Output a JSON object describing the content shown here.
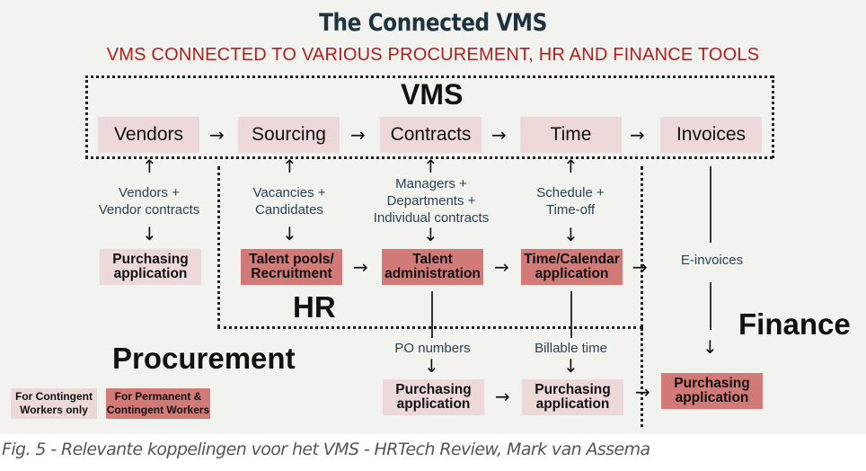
{
  "title": "The Connected VMS",
  "subtitle": "VMS CONNECTED TO VARIOUS PROCUREMENT, HR AND FINANCE TOOLS",
  "zones": {
    "vms": "VMS",
    "hr": "HR",
    "procurement": "Procurement",
    "finance": "Finance"
  },
  "vms_modules": [
    {
      "label": "Vendors"
    },
    {
      "label": "Sourcing"
    },
    {
      "label": "Contracts"
    },
    {
      "label": "Time"
    },
    {
      "label": "Invoices"
    }
  ],
  "flow_notes": {
    "vendors": [
      "Vendors +",
      "Vendor contracts"
    ],
    "sourcing": [
      "Vacancies +",
      "Candidates"
    ],
    "contracts": [
      "Managers +",
      "Departments +",
      "Individual contracts"
    ],
    "time": [
      "Schedule +",
      "Time-off"
    ],
    "e_invoices": "E-invoices",
    "po_numbers": "PO numbers",
    "billable_time": "Billable time"
  },
  "applications": {
    "procurement_purchasing": [
      "Purchasing",
      "application"
    ],
    "talent_pools": [
      "Talent pools/",
      "Recruitment"
    ],
    "talent_admin": [
      "Talent",
      "administration"
    ],
    "time_calendar": [
      "Time/Calendar",
      "application"
    ],
    "purchasing_po": [
      "Purchasing",
      "application"
    ],
    "purchasing_billable": [
      "Purchasing",
      "application"
    ],
    "finance_purchasing": [
      "Purchasing",
      "application"
    ]
  },
  "legend": {
    "contingent_only": [
      "For Contingent",
      "Workers only"
    ],
    "permanent_and_contingent": [
      "For Permanent  &",
      "Contingent Workers"
    ]
  },
  "colors": {
    "title": "#1d3340",
    "subtitle": "#b01f1f",
    "contingent_only_fill": "#ecd9d8",
    "permanent_and_contingent_fill": "#d17a78",
    "background": "#f2f2ee"
  },
  "arrows": {
    "right": "→",
    "up": "↑",
    "down": "↓"
  },
  "caption": "Fig. 5 - Relevante koppelingen voor het VMS - HRTech Review, Mark van Assema"
}
